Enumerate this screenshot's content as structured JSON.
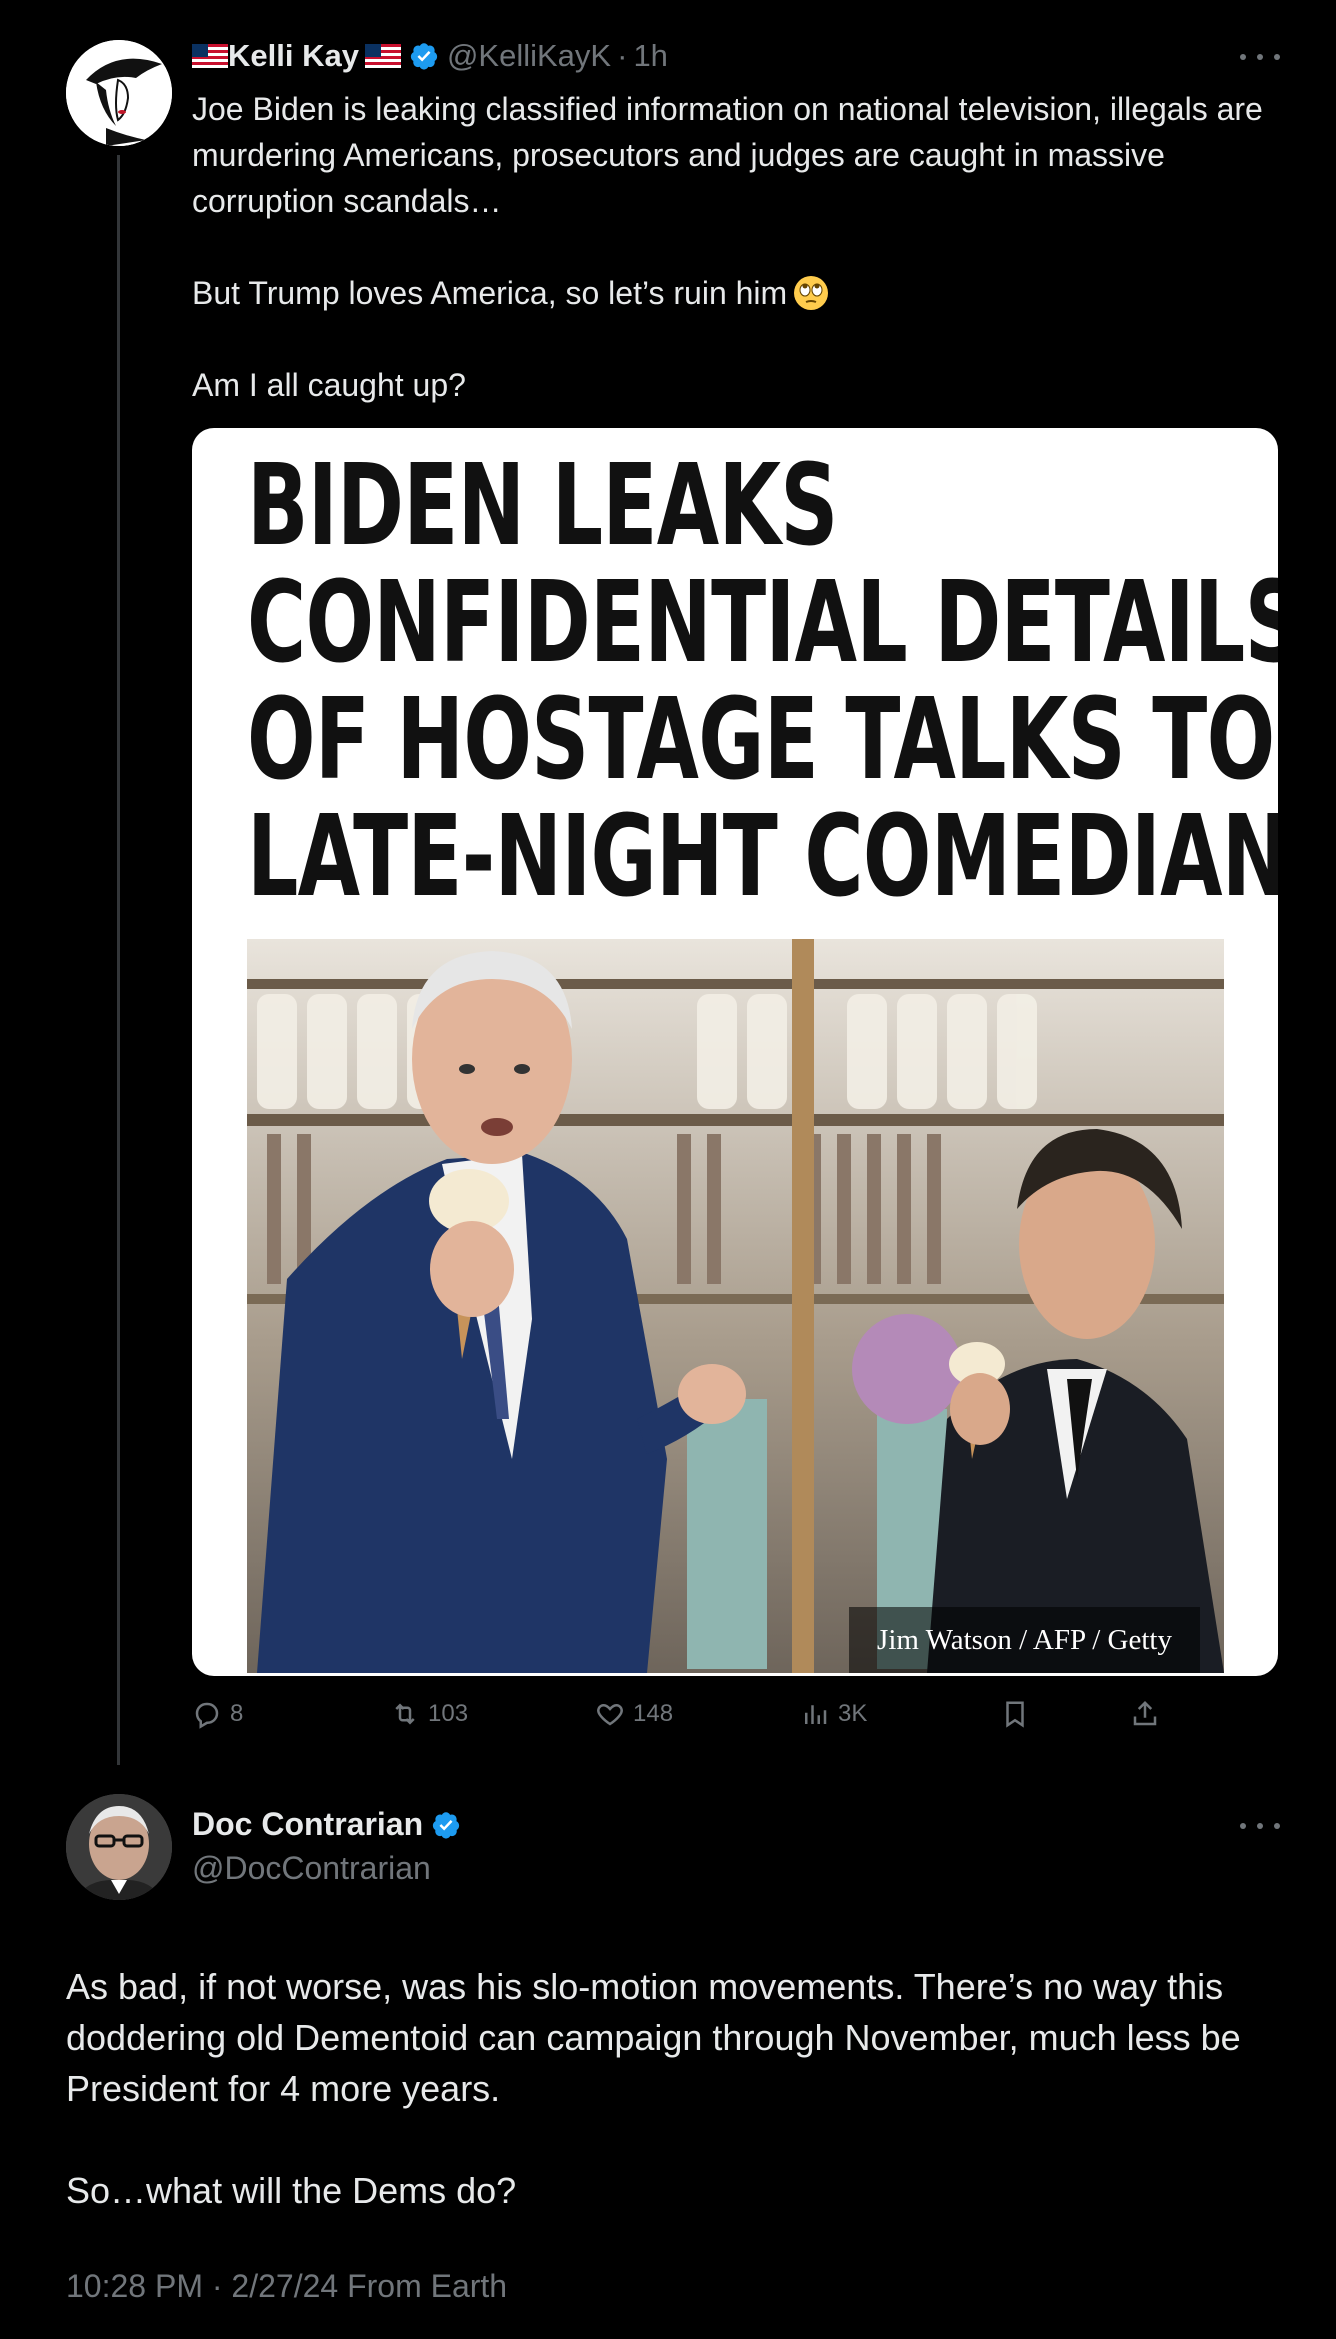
{
  "tweet1": {
    "flag_left": "flag-us",
    "name": "Kelli Kay",
    "flag_right": "flag-us",
    "handle": "@KelliKayK",
    "separator": "·",
    "time": "1h",
    "lines": [
      "Joe Biden is leaking classified information on national television, illegals are murdering Americans, prosecutors and judges are caught in massive corruption scandals…",
      "",
      "But Trump loves America, so let’s ruin him",
      "",
      "Am I all caught up?"
    ],
    "emoji": "face-with-rolling-eyes",
    "media": {
      "headline": [
        "BIDEN LEAKS",
        "CONFIDENTIAL DETAILS",
        "OF HOSTAGE TALKS TO",
        "LATE-NIGHT COMEDIAN"
      ],
      "credit": "Jim Watson / AFP / Getty"
    },
    "actions": {
      "replies": "8",
      "reposts": "103",
      "likes": "148",
      "views": "3K"
    }
  },
  "tweet2": {
    "name": "Doc Contrarian",
    "handle": "@DocContrarian",
    "lines": [
      "As bad, if not worse, was his slo-motion movements. There’s no way this doddering old Dementoid can campaign through November, much less be President for 4 more years.",
      "",
      "So…what will the Dems do?"
    ],
    "meta": "10:28 PM · 2/27/24 From Earth"
  },
  "colors": {
    "background": "#000000",
    "text": "#e7e9ea",
    "muted": "#71767b",
    "verified": "#1d9bf0"
  }
}
